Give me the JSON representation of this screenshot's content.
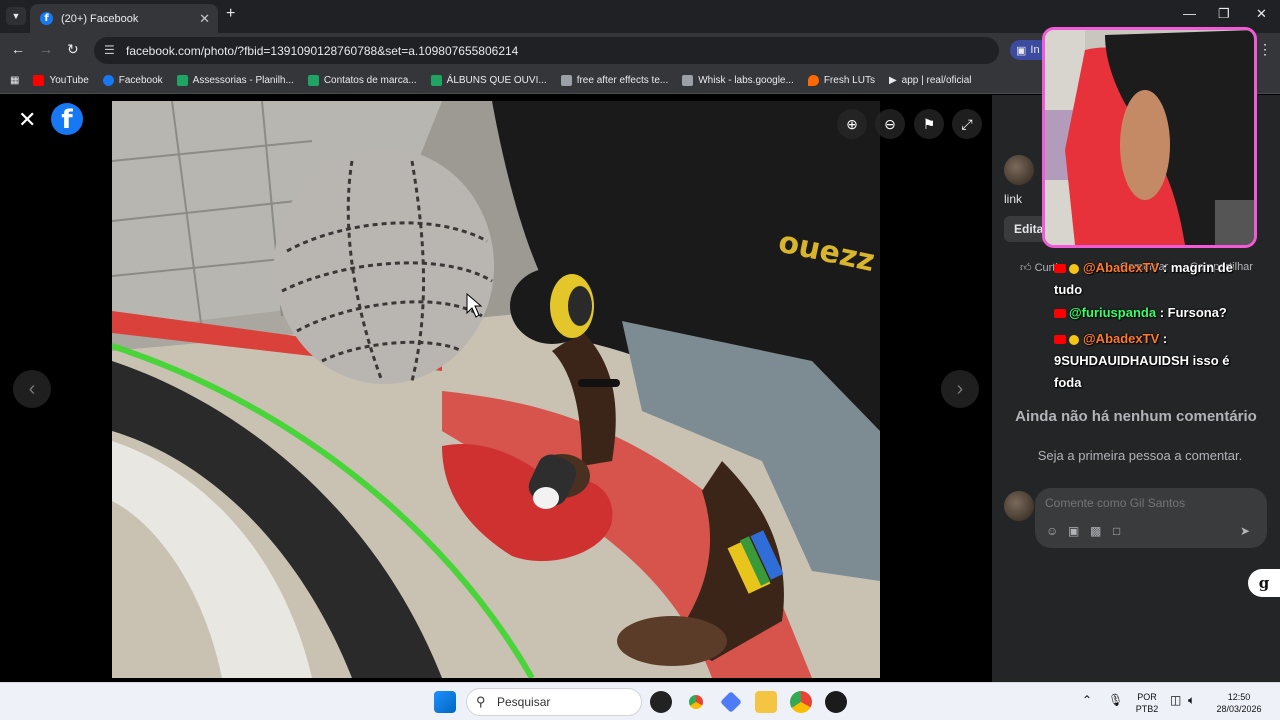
{
  "browser": {
    "tab_title": "(20+) Facebook",
    "url": "facebook.com/photo/?fbid=1391090128760788&set=a.109807655806214",
    "profile_pill": "In",
    "bookmarks": [
      {
        "label": "YouTube",
        "color": "#ff0000"
      },
      {
        "label": "Facebook",
        "color": "#1877f2"
      },
      {
        "label": "Assessorias - Planilh...",
        "color": "#1fa463"
      },
      {
        "label": "Contatos de marca...",
        "color": "#1fa463"
      },
      {
        "label": "ÁLBUNS QUE OUVI...",
        "color": "#1fa463"
      },
      {
        "label": "free after effects te...",
        "color": "#9aa0a6"
      },
      {
        "label": "Whisk - labs.google...",
        "color": "#9aa0a6"
      },
      {
        "label": "Fresh LUTs",
        "color": "#ff6a00"
      },
      {
        "label": "app | real/oficial",
        "color": "#e8eaed"
      }
    ]
  },
  "viewer": {
    "logo_letter": "f"
  },
  "panel": {
    "link": "link",
    "edit": "Edita",
    "like": "Curtir",
    "comment": "Comentar",
    "share": "Compartilhar",
    "no_comments": "Ainda não há nenhum comentário",
    "be_first": "Seja a primeira pessoa a comentar.",
    "comment_placeholder": "Comente como Gil Santos",
    "g_button": "g"
  },
  "chat": [
    {
      "user": "@AbadexTV",
      "message": ": magrin de tudo"
    },
    {
      "user": "@furiuspanda",
      "message": ": Fursona?"
    },
    {
      "user": "@AbadexTV",
      "message": ": 9SUHDAUIDHAUIDSH isso é foda"
    }
  ],
  "taskbar": {
    "search": "Pesquisar",
    "lang_top": "POR",
    "lang_bottom": "PTB2",
    "time": "12:50",
    "date": "28/03/2026"
  }
}
